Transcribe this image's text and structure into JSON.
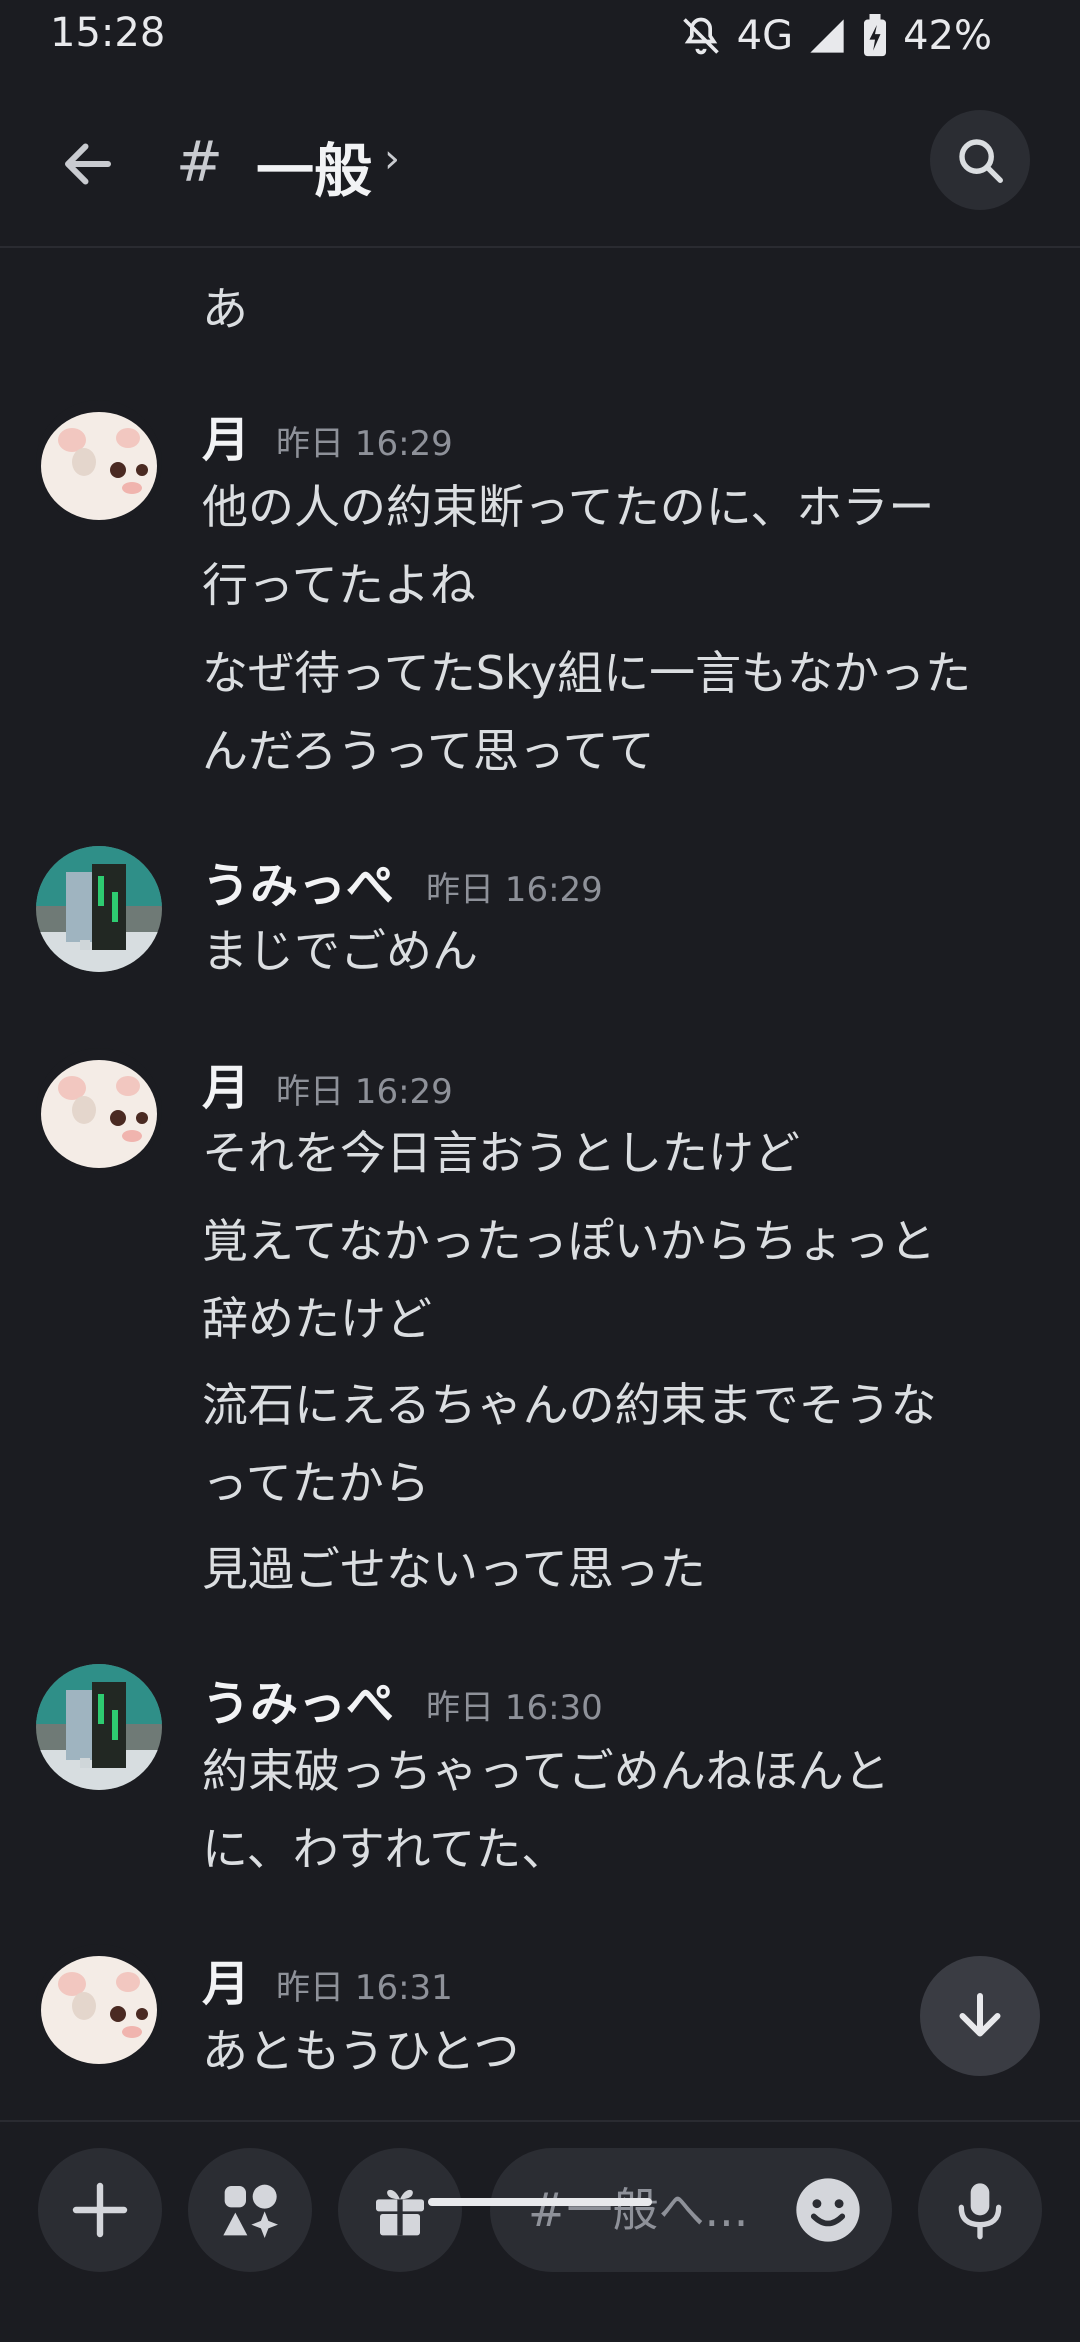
{
  "status_bar": {
    "time": "15:28",
    "network": "4G",
    "battery": "42%"
  },
  "header": {
    "hash": "#",
    "channel": "一般",
    "chevron": "›"
  },
  "messages": {
    "line0": "あ",
    "m1": {
      "name": "月",
      "time": "昨日 16:29",
      "lines": [
        "他の人の約束断ってたのに、ホラー",
        "行ってたよね",
        "なぜ待ってたSky組に一言もなかった",
        "んだろうって思ってて"
      ]
    },
    "m2": {
      "name": "うみっぺ",
      "time": "昨日 16:29",
      "lines": [
        "まじでごめん"
      ]
    },
    "m3": {
      "name": "月",
      "time": "昨日 16:29",
      "lines": [
        "それを今日言おうとしたけど",
        "覚えてなかったっぽいからちょっと",
        "辞めたけど",
        "流石にえるちゃんの約束までそうな",
        "ってたから",
        "見過ごせないって思った"
      ]
    },
    "m4": {
      "name": "うみっぺ",
      "time": "昨日 16:30",
      "lines": [
        "約束破っちゃってごめんねほんと",
        "に、わすれてた、"
      ]
    },
    "m5": {
      "name": "月",
      "time": "昨日 16:31",
      "lines": [
        "あともうひとつ"
      ]
    }
  },
  "composer": {
    "placeholder": "#一般へ..."
  },
  "icons": {
    "back": "arrow-left-icon",
    "search": "search-icon",
    "jump": "arrow-down-icon",
    "add": "plus-icon",
    "apps": "apps-icon",
    "gift": "gift-icon",
    "emoji": "emoji-icon",
    "mic": "microphone-icon"
  },
  "colors": {
    "background": "#1b1c21",
    "surface": "#2b2d33",
    "text": "#dbdee1",
    "muted": "#8e9199"
  }
}
